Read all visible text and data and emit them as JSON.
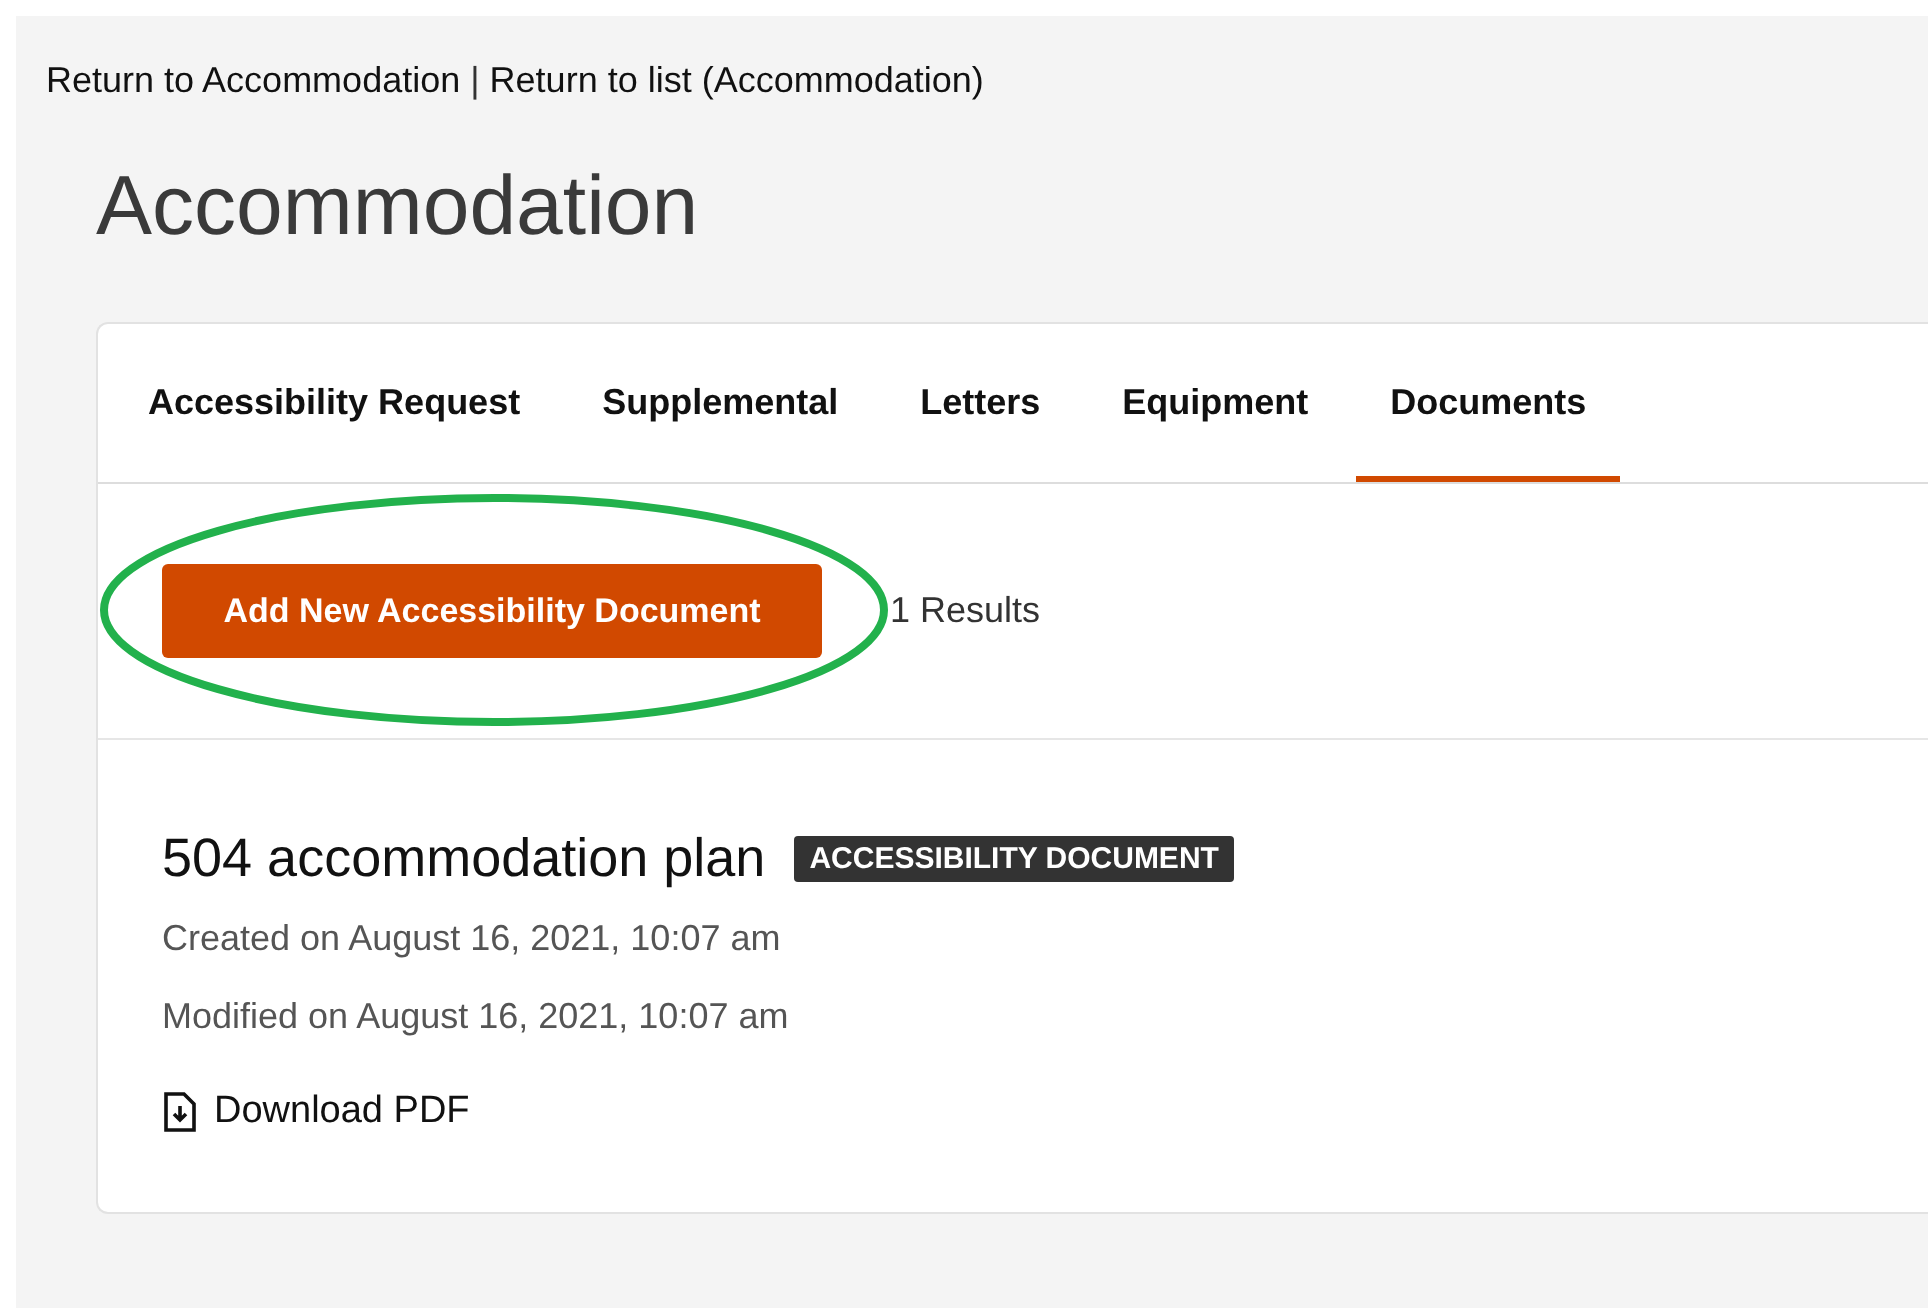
{
  "breadcrumbs": {
    "links": [
      "Return to Accommodation",
      "Return to list (Accommodation)"
    ],
    "separator": "|"
  },
  "page_title": "Accommodation",
  "tabs": [
    {
      "label": "Accessibility Request",
      "selected": false
    },
    {
      "label": "Supplemental",
      "selected": false
    },
    {
      "label": "Letters",
      "selected": false
    },
    {
      "label": "Equipment",
      "selected": false
    },
    {
      "label": "Documents",
      "selected": true
    }
  ],
  "toolbar": {
    "add_button": "Add New Accessibility Document",
    "result_count": "1 Results",
    "highlighted": true
  },
  "documents": [
    {
      "title": "504 accommodation plan",
      "badge": "ACCESSIBILITY DOCUMENT",
      "created": "Created on August 16, 2021, 10:07 am",
      "modified": "Modified on August 16, 2021, 10:07 am",
      "download": "Download PDF"
    }
  ]
}
